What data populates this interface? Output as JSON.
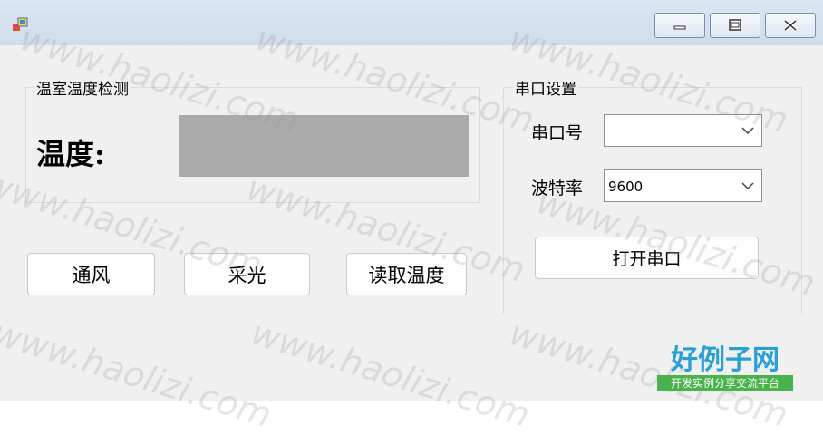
{
  "window": {
    "title": ""
  },
  "temp_group": {
    "title": "温室温度检测",
    "temp_label": "温度:",
    "temp_value": ""
  },
  "actions": {
    "ventilate": "通风",
    "lighting": "采光",
    "read_temp": "读取温度"
  },
  "serial_group": {
    "title": "串口设置",
    "port_label": "串口号",
    "port_value": "",
    "baud_label": "波特率",
    "baud_value": "9600",
    "open_button": "打开串口"
  },
  "watermark": {
    "text": "www.haolizi.com",
    "brand_title": "好例子网",
    "brand_sub": "开发实例分享交流平台"
  }
}
